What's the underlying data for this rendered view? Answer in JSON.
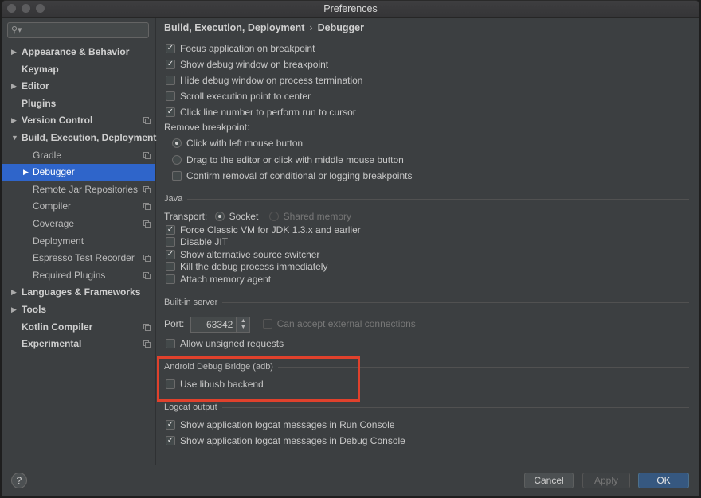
{
  "window": {
    "title": "Preferences"
  },
  "search": {
    "placeholder": ""
  },
  "sidebar": {
    "items": [
      {
        "label": "Appearance & Behavior"
      },
      {
        "label": "Keymap"
      },
      {
        "label": "Editor"
      },
      {
        "label": "Plugins"
      },
      {
        "label": "Version Control"
      },
      {
        "label": "Build, Execution, Deployment"
      },
      {
        "label": "Gradle"
      },
      {
        "label": "Debugger"
      },
      {
        "label": "Remote Jar Repositories"
      },
      {
        "label": "Compiler"
      },
      {
        "label": "Coverage"
      },
      {
        "label": "Deployment"
      },
      {
        "label": "Espresso Test Recorder"
      },
      {
        "label": "Required Plugins"
      },
      {
        "label": "Languages & Frameworks"
      },
      {
        "label": "Tools"
      },
      {
        "label": "Kotlin Compiler"
      },
      {
        "label": "Experimental"
      }
    ]
  },
  "breadcrumb": {
    "parent": "Build, Execution, Deployment",
    "separator": "›",
    "current": "Debugger"
  },
  "general": {
    "focus_app": "Focus application on breakpoint",
    "show_debug_window": "Show debug window on breakpoint",
    "hide_debug_window": "Hide debug window on process termination",
    "scroll_exec_point": "Scroll execution point to center",
    "click_line_number": "Click line number to perform run to cursor",
    "remove_breakpoint_label": "Remove breakpoint:",
    "click_left": "Click with left mouse button",
    "drag_or_middle": "Drag to the editor or click with middle mouse button",
    "confirm_removal": "Confirm removal of conditional or logging breakpoints"
  },
  "java": {
    "section": "Java",
    "transport_label": "Transport:",
    "socket": "Socket",
    "shared_memory": "Shared memory",
    "force_classic": "Force Classic VM for JDK 1.3.x and earlier",
    "disable_jit": "Disable JIT",
    "alt_source": "Show alternative source switcher",
    "kill_process": "Kill the debug process immediately",
    "attach_memory": "Attach memory agent"
  },
  "server": {
    "section": "Built-in server",
    "port_label": "Port:",
    "port_value": "63342",
    "external": "Can accept external connections",
    "unsigned": "Allow unsigned requests"
  },
  "adb": {
    "section": "Android Debug Bridge (adb)",
    "libusb": "Use libusb backend"
  },
  "logcat": {
    "section": "Logcat output",
    "run_console": "Show application logcat messages in Run Console",
    "debug_console": "Show application logcat messages in Debug Console"
  },
  "footer": {
    "help": "?",
    "cancel": "Cancel",
    "apply": "Apply",
    "ok": "OK"
  },
  "colors": {
    "selection": "#2f65ca",
    "highlight": "#e0412c",
    "primary_button": "#365880"
  }
}
